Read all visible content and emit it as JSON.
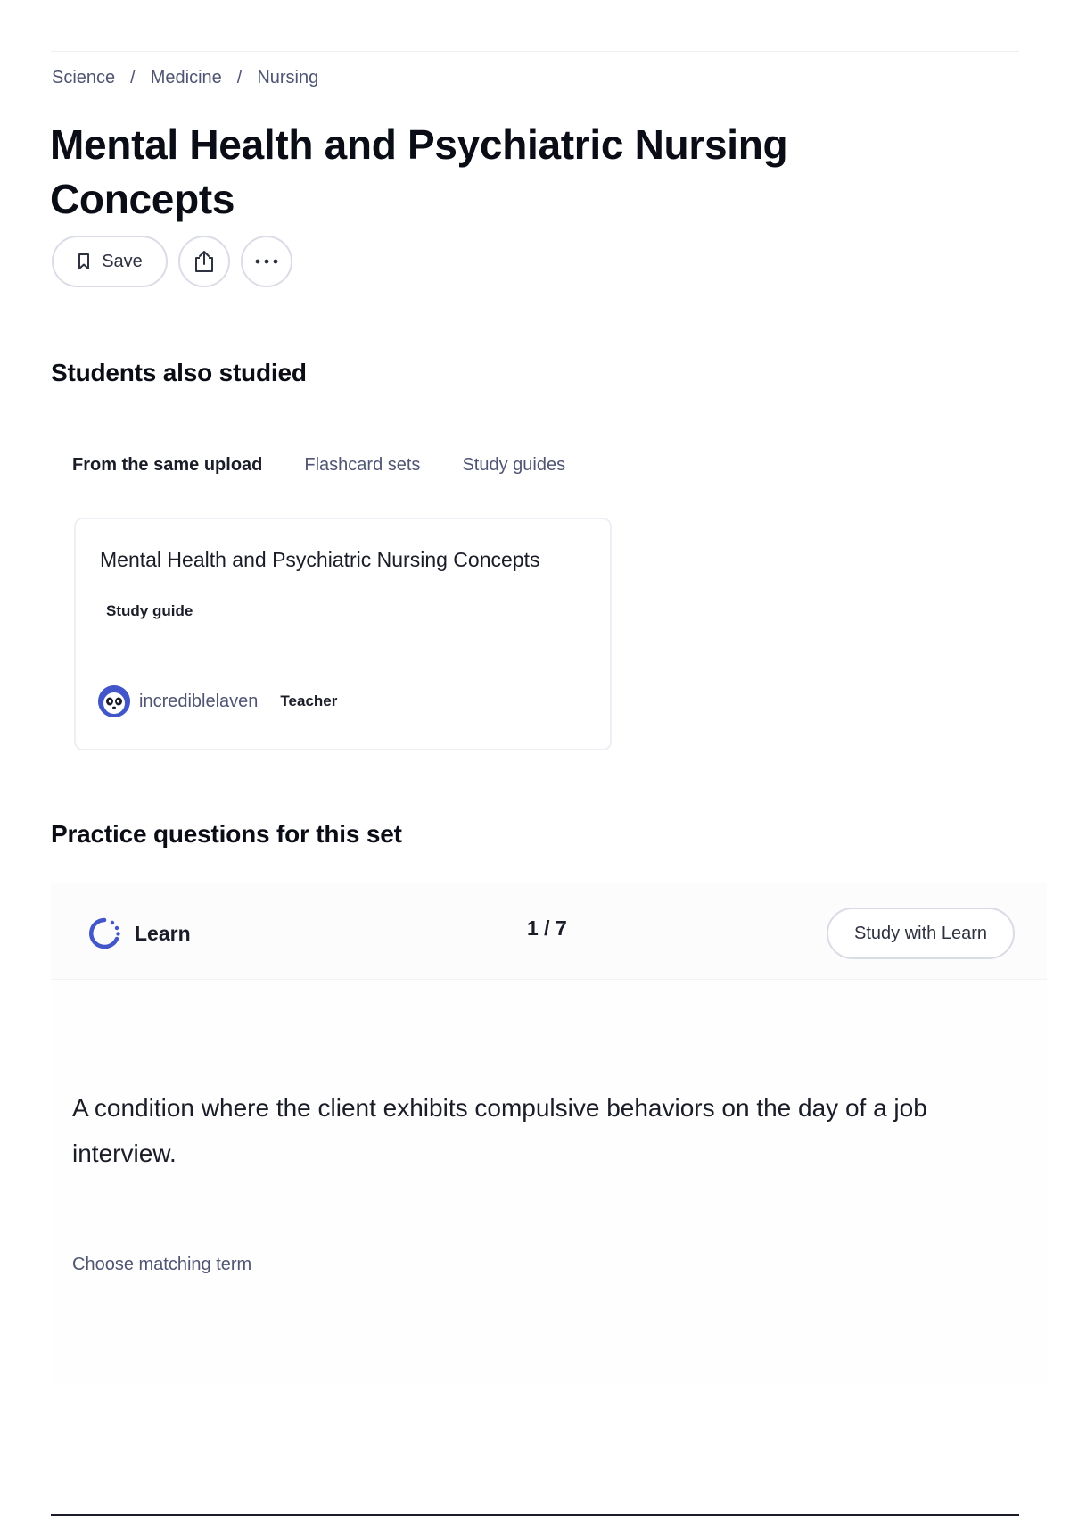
{
  "breadcrumb": {
    "items": [
      "Science",
      "Medicine",
      "Nursing"
    ],
    "separator": "/"
  },
  "page": {
    "title": "Mental Health and Psychiatric Nursing Concepts"
  },
  "actions": {
    "save_label": "Save",
    "save_icon": "bookmark-icon",
    "share_icon": "share-icon",
    "more_icon": "more-horizontal-icon"
  },
  "students_also_studied": {
    "heading": "Students also studied",
    "tabs": [
      "From the same upload",
      "Flashcard sets",
      "Study guides"
    ],
    "active_tab": "From the same upload",
    "card": {
      "title": "Mental Health and Psychiatric Nursing Concepts",
      "type": "Study guide",
      "author": "incrediblelaven",
      "author_role": "Teacher",
      "avatar_icon": "panda-avatar-icon"
    }
  },
  "practice": {
    "heading": "Practice questions for this set",
    "mode_label": "Learn",
    "mode_icon": "learn-progress-icon",
    "progress": "1 / 7",
    "study_button": "Study with Learn",
    "question": "A condition where the client exhibits compulsive behaviors on the day of a job interview.",
    "prompt": "Choose matching term"
  },
  "colors": {
    "text_primary": "#0a0c16",
    "text_secondary": "#4f5572",
    "border": "#dadde6",
    "accent": "#4256c9"
  }
}
